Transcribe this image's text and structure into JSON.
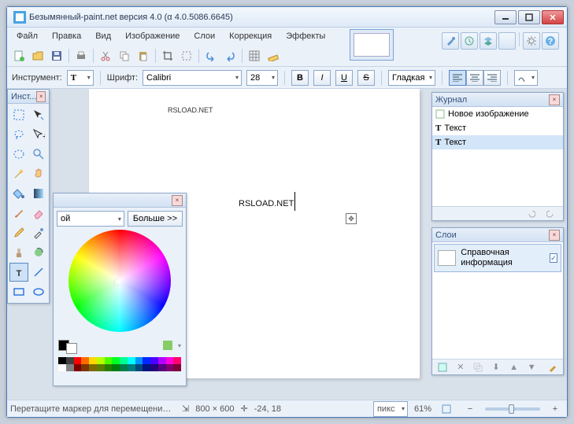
{
  "title": "Безымянный-paint.net версия 4.0 (α 4.0.5086.6645)",
  "menu": [
    "Файл",
    "Правка",
    "Вид",
    "Изображение",
    "Слои",
    "Коррекция",
    "Эффекты"
  ],
  "toolopts": {
    "tool_lbl": "Инструмент:",
    "font_lbl": "Шрифт:",
    "font": "Calibri",
    "size": "28",
    "aa": "Гладкая"
  },
  "panels": {
    "tools_title": "Инст...",
    "colors_more": "Больше >>",
    "history_title": "Журнал",
    "history_items": [
      {
        "icon": "new",
        "label": "Новое изображение"
      },
      {
        "icon": "text",
        "label": "Текст"
      },
      {
        "icon": "text",
        "label": "Текст"
      }
    ],
    "layers_title": "Слои",
    "layer_label": "Справочная информация"
  },
  "canvas": {
    "small": "RSLOAD.NET",
    "big": "RSLOAD.NET"
  },
  "status": {
    "hint": "Перетащите маркер для перемещения текста. Нажмите клавишу...",
    "dims": "800 × 600",
    "coords": "-24, 18",
    "unit": "пикс",
    "zoom": "61%"
  },
  "palette": [
    "#000",
    "#404040",
    "#ff0000",
    "#ff6a00",
    "#ffd800",
    "#b6ff00",
    "#4cff00",
    "#00ff21",
    "#00ff90",
    "#00ffff",
    "#0094ff",
    "#0026ff",
    "#4800ff",
    "#b200ff",
    "#ff00dc",
    "#ff006e",
    "#fff",
    "#808080",
    "#7f0000",
    "#7f3300",
    "#7f6a00",
    "#5b7f00",
    "#267f00",
    "#007f0e",
    "#007f46",
    "#007f7f",
    "#004a7f",
    "#00137f",
    "#25007f",
    "#57007f",
    "#7f006e",
    "#7f0037"
  ]
}
